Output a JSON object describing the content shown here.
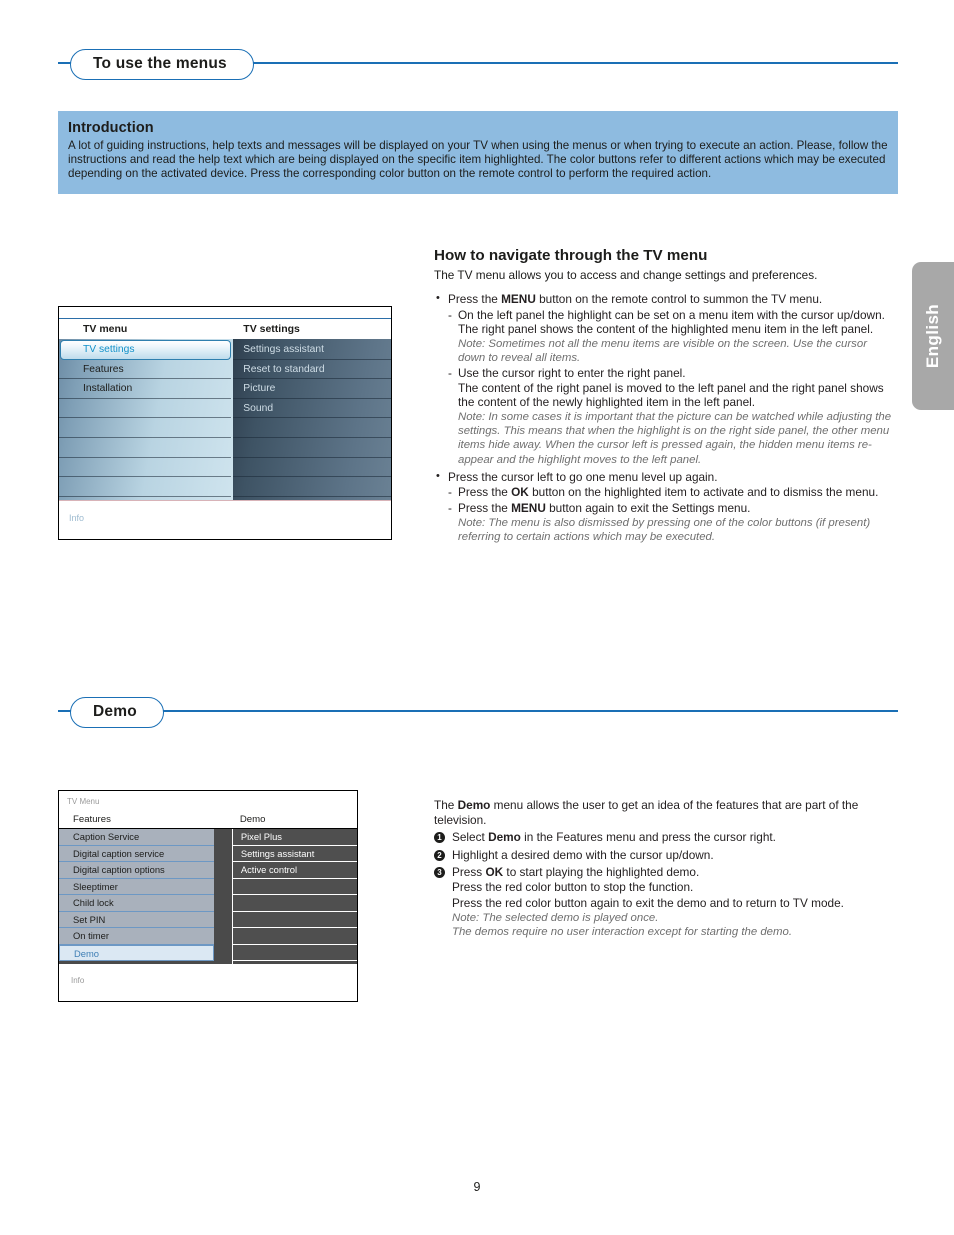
{
  "page": {
    "number": "9",
    "language_tab": "English"
  },
  "section1": {
    "title": "To use the menus",
    "intro": {
      "heading": "Introduction",
      "paragraph": "A lot of guiding instructions, help texts and messages will be displayed on your TV when using the menus or when trying to execute an action. Please, follow the instructions and read the help text which are being displayed on the specific item highlighted. The color buttons refer to different actions which may be executed depending on the activated device. Press the corresponding color button on the remote control to perform the required action."
    },
    "navigate": {
      "heading": "How to navigate through the TV menu",
      "lead": "The TV menu allows you to access and change settings and preferences.",
      "b1": "Press the MENU button on the remote control to summon the TV menu.",
      "b1_s1": "On the left panel the highlight can be set on a menu item with the cursor up/down.",
      "b1_s1_cont": "The right panel shows the content of the highlighted menu item in the left panel.",
      "b1_s1_note": "Note: Sometimes not all the menu items are visible on the screen. Use the cursor down to reveal all items.",
      "b1_s2": "Use the cursor right to enter the right panel.",
      "b1_s2_cont": "The content of the right panel is moved to the left panel and the right panel shows the content of the newly highlighted item in the left panel.",
      "b1_s2_note": "Note: In some cases it is important that the picture can be watched while adjusting the settings. This means that when the highlight is on the right side panel, the other menu items hide away.  When the cursor left is pressed again, the hidden menu items re-appear and the highlight moves to the left panel.",
      "b2": "Press the cursor left to go one menu level up again.",
      "b2_s1": "Press the OK button on the highlighted item to activate and to dismiss the menu.",
      "b2_s2": "Press the MENU button again to exit the Settings menu.",
      "b2_note": "Note: The menu is also dismissed by pressing one of the color buttons (if present) referring to certain actions which may be executed."
    },
    "tv_screen": {
      "left_header": "TV menu",
      "right_header": "TV settings",
      "info_label": "Info",
      "left_items": [
        "TV settings",
        "Features",
        "Installation",
        "",
        "",
        "",
        "",
        ""
      ],
      "left_selected_index": 0,
      "right_items": [
        "Settings assistant",
        "Reset to standard",
        "Picture",
        "Sound",
        "",
        "",
        "",
        ""
      ]
    }
  },
  "section2": {
    "title": "Demo",
    "tv_screen": {
      "top_label": "TV Menu",
      "left_header": "Features",
      "right_header": "Demo",
      "info_label": "Info",
      "left_items": [
        "Caption Service",
        "Digital caption service",
        "Digital caption options",
        "Sleeptimer",
        "Child lock",
        "Set PIN",
        "On timer",
        "Demo"
      ],
      "left_selected_index": 7,
      "right_items": [
        "Pixel Plus",
        "Settings assistant",
        "Active control",
        "",
        "",
        "",
        "",
        ""
      ]
    },
    "text": {
      "lead": "The Demo menu allows the user to get an idea of the features that are part of the television.",
      "step1": "Select Demo in the Features menu and press the cursor right.",
      "step2": "Highlight a desired demo with the cursor up/down.",
      "step3": "Press OK to start playing the highlighted demo.",
      "step3_l2": "Press the red color button to stop the function.",
      "step3_l3": "Press the red color button again to exit the demo and to return to TV mode.",
      "note1": "Note: The selected demo is played once.",
      "note2": "The demos require no user interaction except for starting the demo.",
      "num1": "1",
      "num2": "2",
      "num3": "3"
    }
  },
  "colors": {
    "accent_blue": "#1a6fb5",
    "intro_bg": "#8ebbe0",
    "tab_gray": "#a8a8a8",
    "note_gray": "#6f6f6f"
  }
}
